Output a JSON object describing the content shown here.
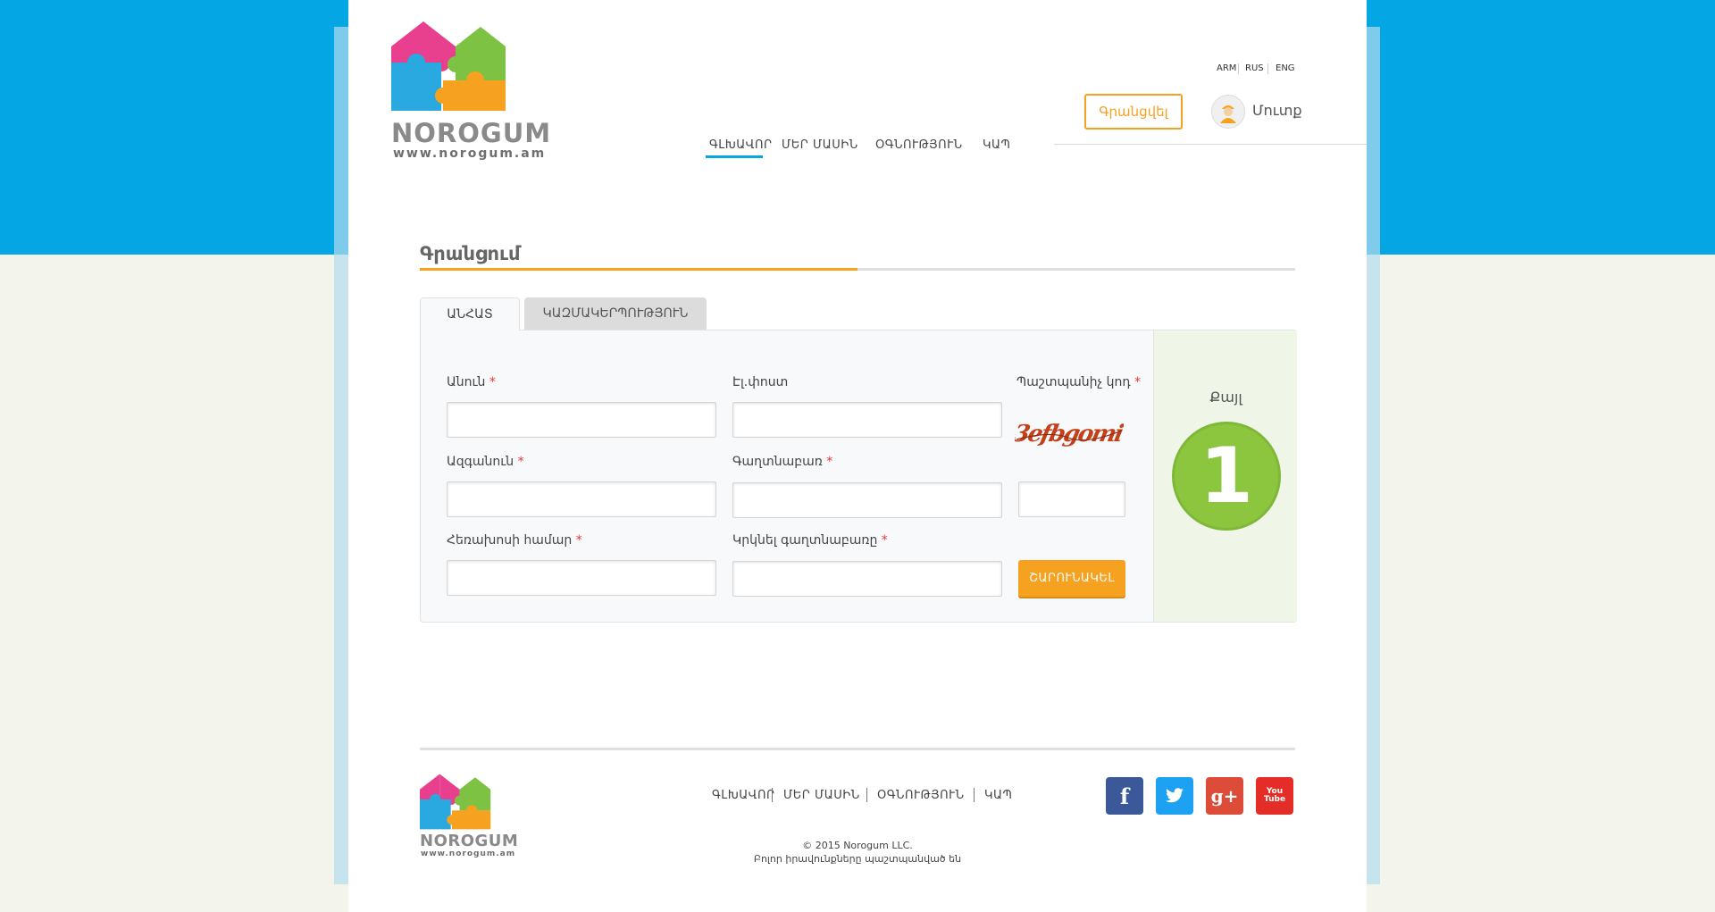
{
  "header": {
    "logo_word": "NOROGUM",
    "logo_url": "www.norogum.am",
    "languages": [
      "ARM",
      "RUS",
      "ENG"
    ],
    "register_label": "Գրանցվել",
    "login_label": "Մուտք",
    "nav": [
      "ԳԼԽԱՎՈՐ",
      "ՄԵՐ ՄԱՍԻՆ",
      "ՕԳՆՈՒԹՅՈՒՆ",
      "ԿԱՊ"
    ]
  },
  "page": {
    "title": "Գրանցում"
  },
  "tabs": [
    "ԱՆՀԱՏ",
    "ԿԱԶՄԱԿԵՐՊՈՒԹՅՈՒՆ"
  ],
  "form": {
    "name_label": "Անուն",
    "surname_label": "Ազգանուն",
    "phone_label": "Հեռախոսի համար",
    "email_label": "Էլ.փոստ",
    "password_label": "Գաղտնաբառ",
    "password_repeat_label": "Կրկնել գաղտնաբառը",
    "captcha_label": "Պաշտպանիչ կոդ",
    "captcha_text": "3efbgomi",
    "required_mark": "*",
    "continue_label": "ՇԱՐՈՒՆԱԿԵԼ",
    "step_label": "Քայլ",
    "step_number": "1"
  },
  "footer": {
    "logo_word": "NOROGUM",
    "logo_url": "www.norogum.am",
    "nav": [
      "ԳԼԽԱՎՈՐ",
      "ՄԵՐ ՄԱՍԻՆ",
      "ՕԳՆՈՒԹՅՈՒՆ",
      "ԿԱՊ"
    ],
    "copyright": "© 2015 Norogum LLC.",
    "rights": "Բոլոր իրավունքները պաշտպանված են",
    "social": [
      {
        "name": "facebook-icon",
        "glyph": "f",
        "color": "#3b5998"
      },
      {
        "name": "twitter-icon",
        "glyph": "t",
        "color": "#1da1f2"
      },
      {
        "name": "google-plus-icon",
        "glyph": "g+",
        "color": "#dd4b39"
      },
      {
        "name": "youtube-icon",
        "glyph": "You Tube",
        "color": "#e52d27"
      }
    ]
  },
  "colors": {
    "brand_blue": "#04a6e4",
    "accent_orange": "#f6a11f",
    "step_green": "#8cc63f"
  }
}
